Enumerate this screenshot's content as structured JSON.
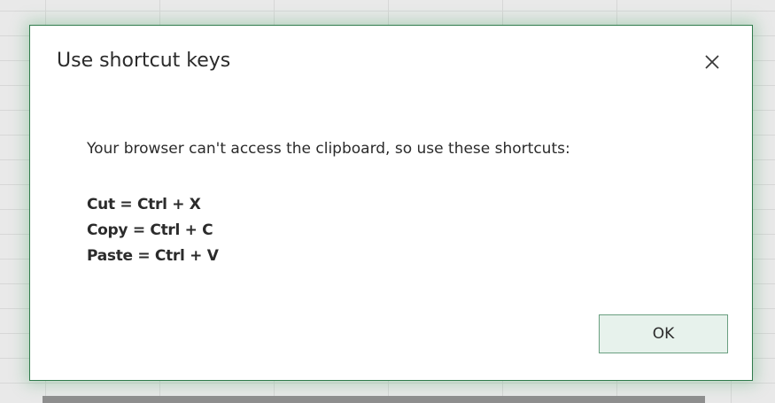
{
  "dialog": {
    "title": "Use shortcut keys",
    "close_icon": "close-icon",
    "message": "Your browser can't access the clipboard, so use these shortcuts:",
    "shortcuts": [
      "Cut = Ctrl + X",
      "Copy = Ctrl + C",
      "Paste = Ctrl + V"
    ],
    "ok_label": "OK"
  },
  "colors": {
    "accent_border": "#2f7a4b",
    "button_fill": "#e7f2ec",
    "button_border": "#6a9f80",
    "text": "#2b2b2b",
    "background_sheet": "#e9e9e9"
  }
}
